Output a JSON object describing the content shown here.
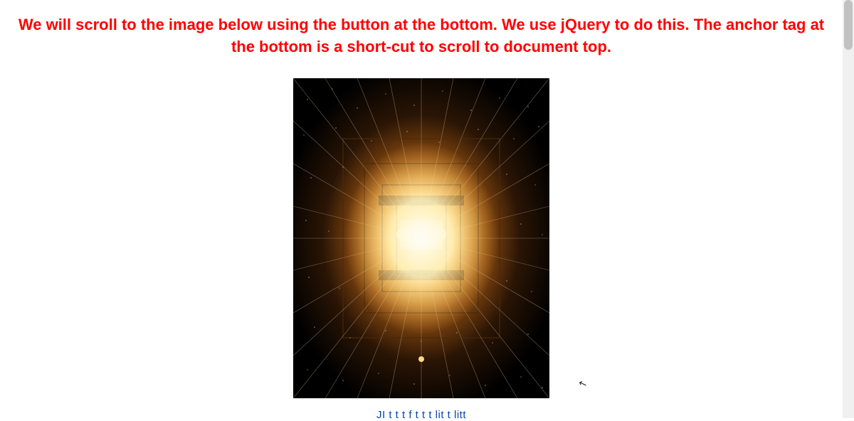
{
  "heading_text": "We will scroll to the image below using the button at the bottom. We use jQuery to do this. The anchor tag at the bottom is a short-cut to scroll to document top.",
  "image_alt": "perspective-light-art",
  "partial_link_fragment": "JI                t  t        t         f t    t  t            lit        t litt"
}
